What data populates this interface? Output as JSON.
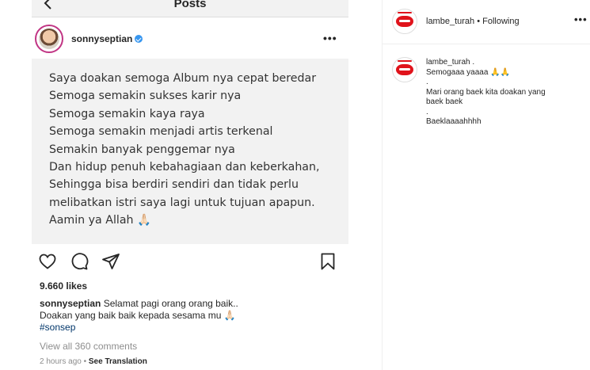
{
  "phone": {
    "title": "Posts",
    "post": {
      "username": "sonnyseptian",
      "image_lines": [
        "Saya doakan semoga Album nya cepat beredar",
        "Semoga semakin sukses karir nya",
        "Semoga semakin kaya raya",
        "Semoga semakin menjadi artis terkenal",
        "Semakin banyak penggemar nya",
        "Dan hidup penuh kebahagiaan dan keberkahan,",
        "Sehingga bisa berdiri sendiri dan tidak perlu",
        "melibatkan istri saya lagi untuk tujuan apapun.",
        "Aamin ya Allah 🙏🏻"
      ],
      "likes": "9.660 likes",
      "caption_user": "sonnyseptian",
      "caption_line1": " Selamat pagi orang orang baik..",
      "caption_line2": "Doakan yang baik baik kepada sesama mu 🙏🏻",
      "hashtag": "#sonsep",
      "view_comments": "View all 360 comments",
      "time": "2 hours ago",
      "separator": " • ",
      "see_translation": "See Translation"
    }
  },
  "sidebar": {
    "header_username": "lambe_turah",
    "header_following": " • Following",
    "comment": {
      "username": "lambe_turah .",
      "lines": [
        "Semogaaa yaaaa 🙏🙏",
        ".",
        "Mari orang baek kita doakan yang",
        "baek baek",
        ".",
        "Baeklaaaahhhh"
      ]
    }
  },
  "colors": {
    "verified": "#3897f0",
    "brand_red": "#e0131b",
    "muted": "#8e8e8e",
    "hashtag": "#003569"
  },
  "icons": [
    "back-arrow-icon",
    "more-icon",
    "heart-icon",
    "comment-icon",
    "share-icon",
    "bookmark-icon",
    "verified-icon"
  ]
}
